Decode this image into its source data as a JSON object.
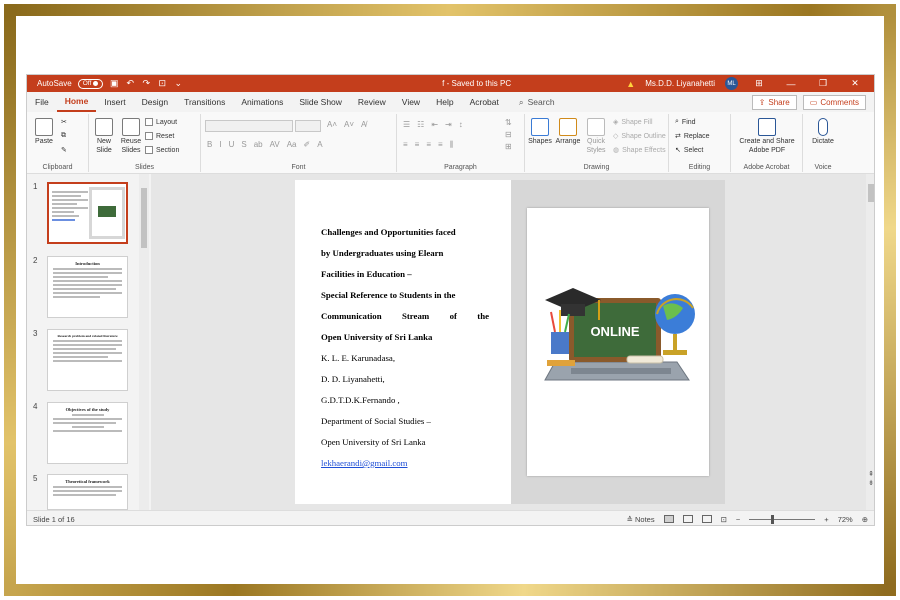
{
  "titlebar": {
    "autosave_label": "AutoSave",
    "autosave_state": "Off",
    "doc_title": "f - Saved to this PC",
    "user_name": "Ms.D.D. Liyanahetti",
    "user_initials": "ML"
  },
  "menu": {
    "tabs": [
      "File",
      "Home",
      "Insert",
      "Design",
      "Transitions",
      "Animations",
      "Slide Show",
      "Review",
      "View",
      "Help",
      "Acrobat"
    ],
    "active_tab": "Home",
    "search_label": "Search",
    "share_label": "Share",
    "comments_label": "Comments"
  },
  "ribbon": {
    "clipboard": {
      "paste": "Paste",
      "label": "Clipboard"
    },
    "slides": {
      "new_slide": "New Slide",
      "reuse_slides": "Reuse Slides",
      "layout": "Layout",
      "reset": "Reset",
      "section": "Section",
      "label": "Slides"
    },
    "font": {
      "label": "Font"
    },
    "paragraph": {
      "label": "Paragraph"
    },
    "drawing": {
      "shapes": "Shapes",
      "arrange": "Arrange",
      "quick_styles": "Quick Styles",
      "shape_fill": "Shape Fill",
      "shape_outline": "Shape Outline",
      "shape_effects": "Shape Effects",
      "label": "Drawing"
    },
    "editing": {
      "find": "Find",
      "replace": "Replace",
      "select": "Select",
      "label": "Editing"
    },
    "acrobat": {
      "create_share": "Create and Share Adobe PDF",
      "label": "Adobe Acrobat"
    },
    "voice": {
      "dictate": "Dictate",
      "label": "Voice"
    }
  },
  "thumbnails": [
    {
      "num": "1",
      "title": ""
    },
    {
      "num": "2",
      "title": "Introduction"
    },
    {
      "num": "3",
      "title": "Research problem and related literature"
    },
    {
      "num": "4",
      "title": "Objectives of the study"
    },
    {
      "num": "5",
      "title": "Theoretical framework"
    }
  ],
  "slide": {
    "title_lines": [
      "Challenges and Opportunities faced",
      "by Undergraduates using Elearn",
      "Facilities in Education –",
      "Special Reference to Students in the",
      "Communication Stream of the",
      "Open University of Sri Lanka"
    ],
    "authors": [
      "K. L. E. Karunadasa,",
      "D. D. Liyanahetti,",
      "G.D.T.D.K.Fernando ,"
    ],
    "department": "Department of Social Studies –",
    "university": "Open University of Sri Lanka",
    "email": "lekhaerandi@gmail.com",
    "image_text": "ONLINE"
  },
  "statusbar": {
    "slide_info": "Slide 1 of 16",
    "notes_label": "Notes",
    "zoom": "72%",
    "zoom_level": 0.72
  },
  "colors": {
    "accent": "#c43e1c",
    "link": "#1f4fd6",
    "frame": "#b08a2e"
  }
}
